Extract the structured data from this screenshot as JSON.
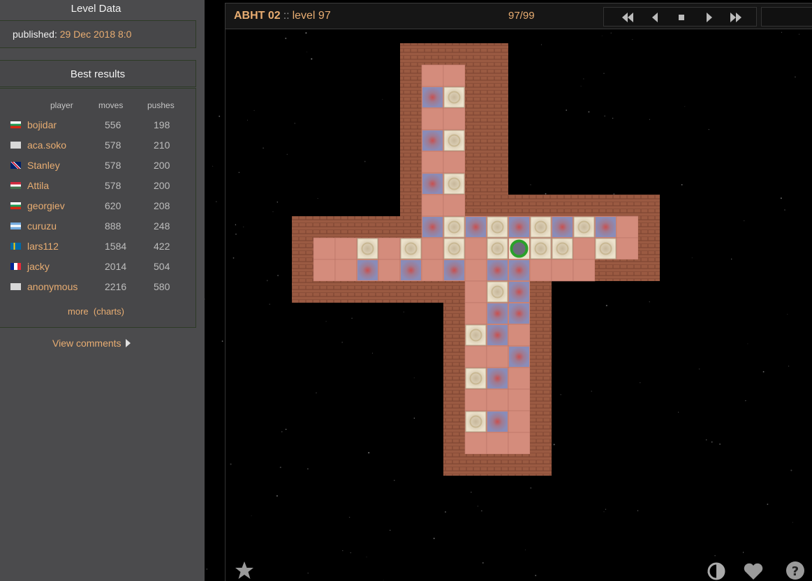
{
  "sidebar": {
    "level_data_title": "Level Data",
    "published_label": "published:",
    "published_value": "29 Dec 2018 8:0",
    "best_results_title": "Best results",
    "columns": {
      "player": "player",
      "moves": "moves",
      "pushes": "pushes"
    },
    "results": [
      {
        "flag": "bg",
        "player": "bojidar",
        "moves": "556",
        "pushes": "198"
      },
      {
        "flag": "none",
        "player": "aca.soko",
        "moves": "578",
        "pushes": "210"
      },
      {
        "flag": "gb",
        "player": "Stanley",
        "moves": "578",
        "pushes": "200"
      },
      {
        "flag": "hu",
        "player": "Attila",
        "moves": "578",
        "pushes": "200"
      },
      {
        "flag": "bg",
        "player": "georgiev",
        "moves": "620",
        "pushes": "208"
      },
      {
        "flag": "ar",
        "player": "curuzu",
        "moves": "888",
        "pushes": "248"
      },
      {
        "flag": "se",
        "player": "lars112",
        "moves": "1584",
        "pushes": "422"
      },
      {
        "flag": "fr",
        "player": "jacky",
        "moves": "2014",
        "pushes": "504"
      },
      {
        "flag": "none",
        "player": "anonymous",
        "moves": "2216",
        "pushes": "580"
      }
    ],
    "more_label": "more",
    "charts_label": "(charts)",
    "view_comments": "View comments"
  },
  "header": {
    "collection": "ABHT 02",
    "separator": "::",
    "level": "level 97",
    "counter": "97/99"
  },
  "colors": {
    "accent": "#e8ad72",
    "wall": "#9c5a40",
    "floor": "#d48c7c",
    "goal": "#9a8aa6",
    "box": "#e4d6bc",
    "player": "#2aa12a"
  },
  "board": {
    "rows": [
      "     #####    ",
      "     #  ##    ",
      "     #.$##    ",
      "     #  ##    ",
      "     #.$##    ",
      "     #  ##    ",
      "     #.$##    ",
      "     #  #########",
      "######.$.$.$.$. #",
      "#  $ $ $ $@$$ $ #",
      "#  . . . ..   ###",
      "######## $.#     ",
      "       # ..#     ",
      "       #$. #     ",
      "       #  .#     ",
      "       #$. #     ",
      "       #   #     ",
      "       #$. #     ",
      "       #   #     ",
      "       #####     "
    ]
  },
  "icons": {
    "nav": [
      "first-icon",
      "prev-icon",
      "stop-icon",
      "next-icon",
      "last-icon"
    ],
    "bottom": [
      "star-icon",
      "contrast-icon",
      "heart-icon",
      "help-icon"
    ]
  }
}
